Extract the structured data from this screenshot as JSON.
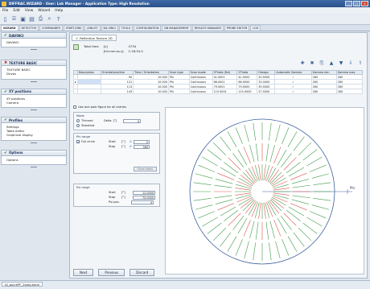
{
  "window": {
    "title": "DIFFRAC.WIZARD - User: Lab Manager - Application Type: High Resolution",
    "buttons": [
      "_",
      "□",
      "×"
    ]
  },
  "menu": [
    "File",
    "Edit",
    "View",
    "Wizard",
    "Help"
  ],
  "toolbar_icons": [
    "new-icon",
    "open-icon",
    "save-icon",
    "save-all-icon",
    "print-icon",
    "print-preview-icon",
    "help-icon"
  ],
  "tabs": [
    "WIZARD",
    "DETECTOR",
    "COMMANDER",
    "START JOBS",
    "JOBLIST",
    "DA VINCI",
    "TOOLS",
    "CONFIGURATION",
    "DB MANAGEMENT",
    "RESULTS MANAGER",
    "PROBE EDITOR",
    "LOG"
  ],
  "sidebar": {
    "sections": [
      {
        "title": "DAVINCI",
        "items": [
          "DAVINCI"
        ]
      },
      {
        "title": "TEXTURE BASIC",
        "items": [
          "TEXTURE BASIC",
          "Drives"
        ]
      },
      {
        "title": "XY positions",
        "items": [
          "XY positions",
          "Camera"
        ]
      },
      {
        "title": "Profiles",
        "items": [
          "Settings",
          "Table editor",
          "Graphical display"
        ]
      },
      {
        "title": "Options",
        "items": [
          "Options"
        ]
      }
    ]
  },
  "panel": {
    "tab_label": "Reflection Texture 2D",
    "total_time_label": "Total time",
    "total_time_unit1": "[s]",
    "total_time_unit2": "[hh:mm:ss.s]",
    "total_time_value1": "4734",
    "total_time_value2": "1:18:54.0"
  },
  "table": {
    "columns": [
      "Description",
      "Orientations/line",
      "Time / Orientation",
      "Scan type",
      "Scan mode",
      "2Theta (fixl)",
      "2Theta",
      "Omega",
      "Automatic Gamma",
      "Gamma min",
      "Gamma max"
    ],
    "rows": [
      [
        "",
        "90",
        "10.000",
        "Phi",
        "Continuous",
        "41.0001",
        "41.0000",
        "20.5000",
        "✓",
        "260",
        "280"
      ],
      [
        "",
        "121",
        "10.000",
        "Phi",
        "Continuous",
        "66.0001",
        "66.0000",
        "33.0000",
        "✓",
        "260",
        "280"
      ],
      [
        "",
        "113",
        "10.000",
        "Phi",
        "Continuous",
        "79.0001",
        "79.0000",
        "39.5000",
        "✓",
        "260",
        "280"
      ],
      [
        "",
        "143",
        "10.000",
        "Phi",
        "Continuous",
        "115.0001",
        "115.0000",
        "57.5000",
        "✓",
        "260",
        "280"
      ]
    ]
  },
  "options": {
    "use_one_pole": "Use one pole figure for all entries",
    "mode_title": "Mode",
    "thinned": "Thinned",
    "delta_label": "Delta",
    "delta_unit": "[°]",
    "delta_value": "0",
    "standard": "Standard",
    "phi_range_title": "Phi range",
    "full_circle": "Full circle",
    "start_label": "Start",
    "start_unit": "[°]",
    "phi_start": "0",
    "stop_label": "Stop",
    "stop_unit": "[°]",
    "phi_stop": "360",
    "show_steps": "Show steps",
    "psi_range_title": "Psi range",
    "psi_start": "12.0000",
    "psi_stop": "75.0000",
    "psi_pos_label": "Psi pos.",
    "psi_pos": "4"
  },
  "polefigure": {
    "axis_label": "Phi"
  },
  "buttons": {
    "next": "Next",
    "previous": "Previous",
    "discard": "Discard"
  },
  "statusbar": {
    "file": "AI_quickPF_2step.bsml"
  }
}
